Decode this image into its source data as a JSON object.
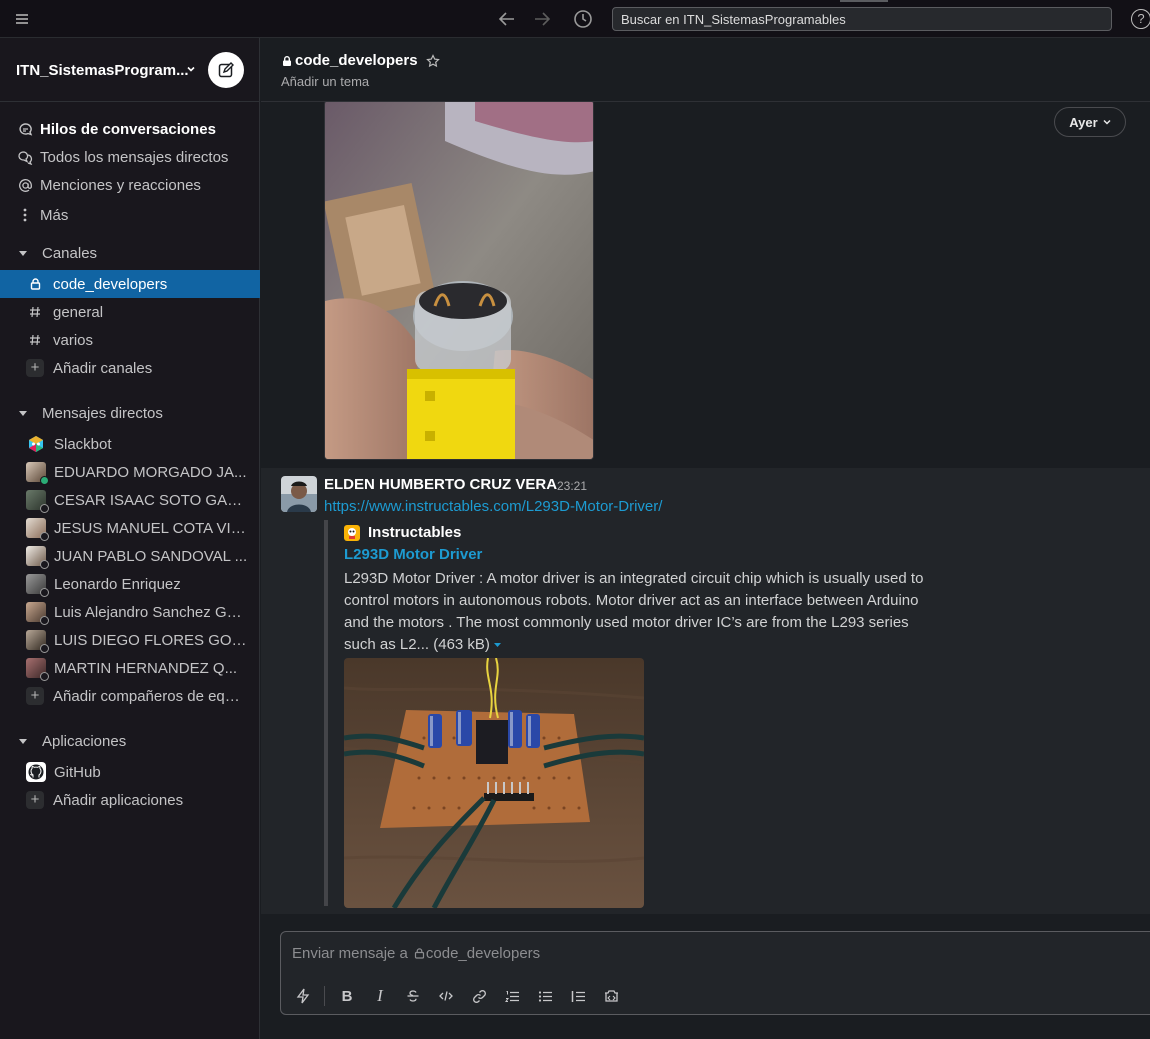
{
  "topbar": {
    "search_placeholder": "Buscar en ITN_SistemasProgramables",
    "help_label": "?"
  },
  "workspace": {
    "name": "ITN_SistemasProgram..."
  },
  "nav": {
    "threads": "Hilos de conversaciones",
    "all_dms": "Todos los mensajes directos",
    "mentions": "Menciones y reacciones",
    "more": "Más"
  },
  "channels": {
    "section": "Canales",
    "items": [
      {
        "name": "code_developers",
        "type": "private",
        "active": true
      },
      {
        "name": "general",
        "type": "public",
        "active": false
      },
      {
        "name": "varios",
        "type": "public",
        "active": false
      }
    ],
    "add": "Añadir canales"
  },
  "dms": {
    "section": "Mensajes directos",
    "items": [
      {
        "name": "Slackbot",
        "status": "bot"
      },
      {
        "name": "EDUARDO MORGADO JA...",
        "status": "online"
      },
      {
        "name": "CESAR ISAAC SOTO GAR...",
        "status": "away"
      },
      {
        "name": "JESUS MANUEL COTA VIL...",
        "status": "away"
      },
      {
        "name": "JUAN PABLO SANDOVAL ...",
        "status": "away"
      },
      {
        "name": "Leonardo Enriquez",
        "status": "away"
      },
      {
        "name": "Luis Alejandro Sanchez Gall...",
        "status": "away"
      },
      {
        "name": "LUIS DIEGO FLORES GON...",
        "status": "away"
      },
      {
        "name": "MARTIN HERNANDEZ Q...",
        "status": "away"
      }
    ],
    "add": "Añadir compañeros de equi..."
  },
  "apps": {
    "section": "Aplicaciones",
    "items": [
      {
        "name": "GitHub"
      }
    ],
    "add": "Añadir aplicaciones"
  },
  "channel": {
    "name": "code_developers",
    "topic": "Añadir un tema",
    "day_divider": "Ayer"
  },
  "message": {
    "sender": "ELDEN HUMBERTO CRUZ VERA",
    "time": "23:21",
    "link": "https://www.instructables.com/L293D-Motor-Driver/",
    "attachment": {
      "source": "Instructables",
      "title": "L293D Motor Driver",
      "description": "L293D Motor Driver : A motor driver is an integrated circuit chip which is usually used to control motors in autonomous robots. Motor driver act as an interface between Arduino and the motors . The most commonly used motor driver IC’s are from the L293 series such as L2...",
      "size": "(463 kB)"
    }
  },
  "composer": {
    "placeholder_prefix": "Enviar mensaje a",
    "placeholder_channel": "code_developers",
    "bold": "B",
    "italic": "I"
  },
  "colors": {
    "accent": "#1164a3",
    "link": "#1d9bd1",
    "online": "#2bac76",
    "background": "#1a1d21",
    "sidebar": "#19171d"
  }
}
